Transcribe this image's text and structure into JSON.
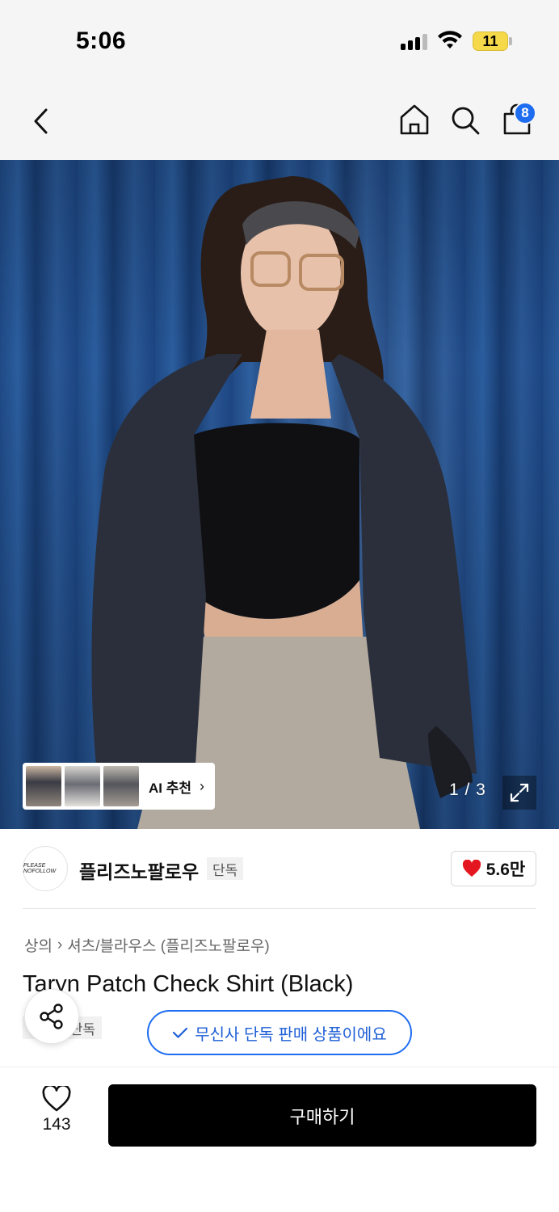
{
  "status_bar": {
    "time": "5:06",
    "battery": "11"
  },
  "nav": {
    "cart_count": "8"
  },
  "gallery": {
    "ai_label": "AI 추천",
    "page_counter": "1 / 3"
  },
  "brand": {
    "name": "플리즈노팔로우",
    "tag": "단독",
    "logo_text": "PLEASE NOFOLLOW",
    "likes": "5.6만"
  },
  "product": {
    "breadcrumb": [
      "상의",
      "셔츠/블라우스 (플리즈노팔로우)"
    ],
    "title": "Taryn Patch Check Shirt (Black)",
    "tag": "단독",
    "exclusive_notice": "무신사 단독 판매 상품이에요"
  },
  "bottom": {
    "wish_count": "143",
    "buy_label": "구매하기"
  },
  "colors": {
    "accent": "#1e6df0",
    "heart": "#e4161f",
    "buy_bg": "#000000"
  }
}
